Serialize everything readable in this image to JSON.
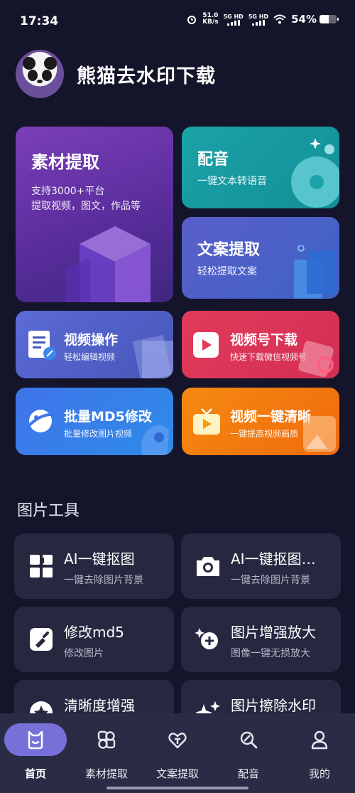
{
  "status_bar": {
    "time": "17:34",
    "net_speed_value": "51.0",
    "net_speed_unit": "KB/s",
    "signal_1": "5G HD",
    "signal_2": "5G HD",
    "battery": "54%",
    "battery_level": 0.54,
    "icons": [
      "alarm-icon",
      "signal-icon",
      "signal-icon",
      "wifi-icon",
      "battery-icon"
    ]
  },
  "header": {
    "title": "熊猫去水印下载"
  },
  "feature_cards": {
    "material": {
      "title": "素材提取",
      "sub1": "支持3000+平台",
      "sub2": "提取视频，图文，作品等"
    },
    "dub": {
      "title": "配音",
      "sub": "一键文本转语音"
    },
    "copy": {
      "title": "文案提取",
      "sub": "轻松提取文案"
    },
    "video_op": {
      "title": "视频操作",
      "sub": "轻松编辑视频"
    },
    "channel": {
      "title": "视频号下载",
      "sub": "快速下载微信视频号"
    },
    "md5": {
      "title": "批量MD5修改",
      "sub": "批量修改图片视频"
    },
    "clear": {
      "title": "视频一键清晰",
      "sub": "一键提高视频画质"
    }
  },
  "image_tools": {
    "section_title": "图片工具",
    "items": [
      {
        "title": "AI一键抠图",
        "sub": "一键去除图片背景",
        "icon": "grid-icon"
      },
      {
        "title": "AI一键抠图…",
        "sub": "一键去除图片背景",
        "icon": "camera-icon"
      },
      {
        "title": "修改md5",
        "sub": "修改图片",
        "icon": "brush-icon"
      },
      {
        "title": "图片增强放大",
        "sub": "图像一键无损放大",
        "icon": "zoom-sparkle-icon"
      },
      {
        "title": "清晰度增强",
        "sub": "",
        "icon": "star-badge-icon"
      },
      {
        "title": "图片擦除水印",
        "sub": "",
        "icon": "sparkle-icon"
      }
    ]
  },
  "bottom_nav": {
    "items": [
      {
        "label": "首页",
        "icon": "home-icon",
        "active": true
      },
      {
        "label": "素材提取",
        "icon": "material-icon",
        "active": false
      },
      {
        "label": "文案提取",
        "icon": "copy-extract-icon",
        "active": false
      },
      {
        "label": "配音",
        "icon": "dub-icon",
        "active": false
      },
      {
        "label": "我的",
        "icon": "profile-icon",
        "active": false
      }
    ]
  },
  "colors": {
    "background": "#14142a",
    "tool_card": "#272840",
    "nav_bg": "#2a2b44",
    "nav_active": "#7770d8"
  }
}
